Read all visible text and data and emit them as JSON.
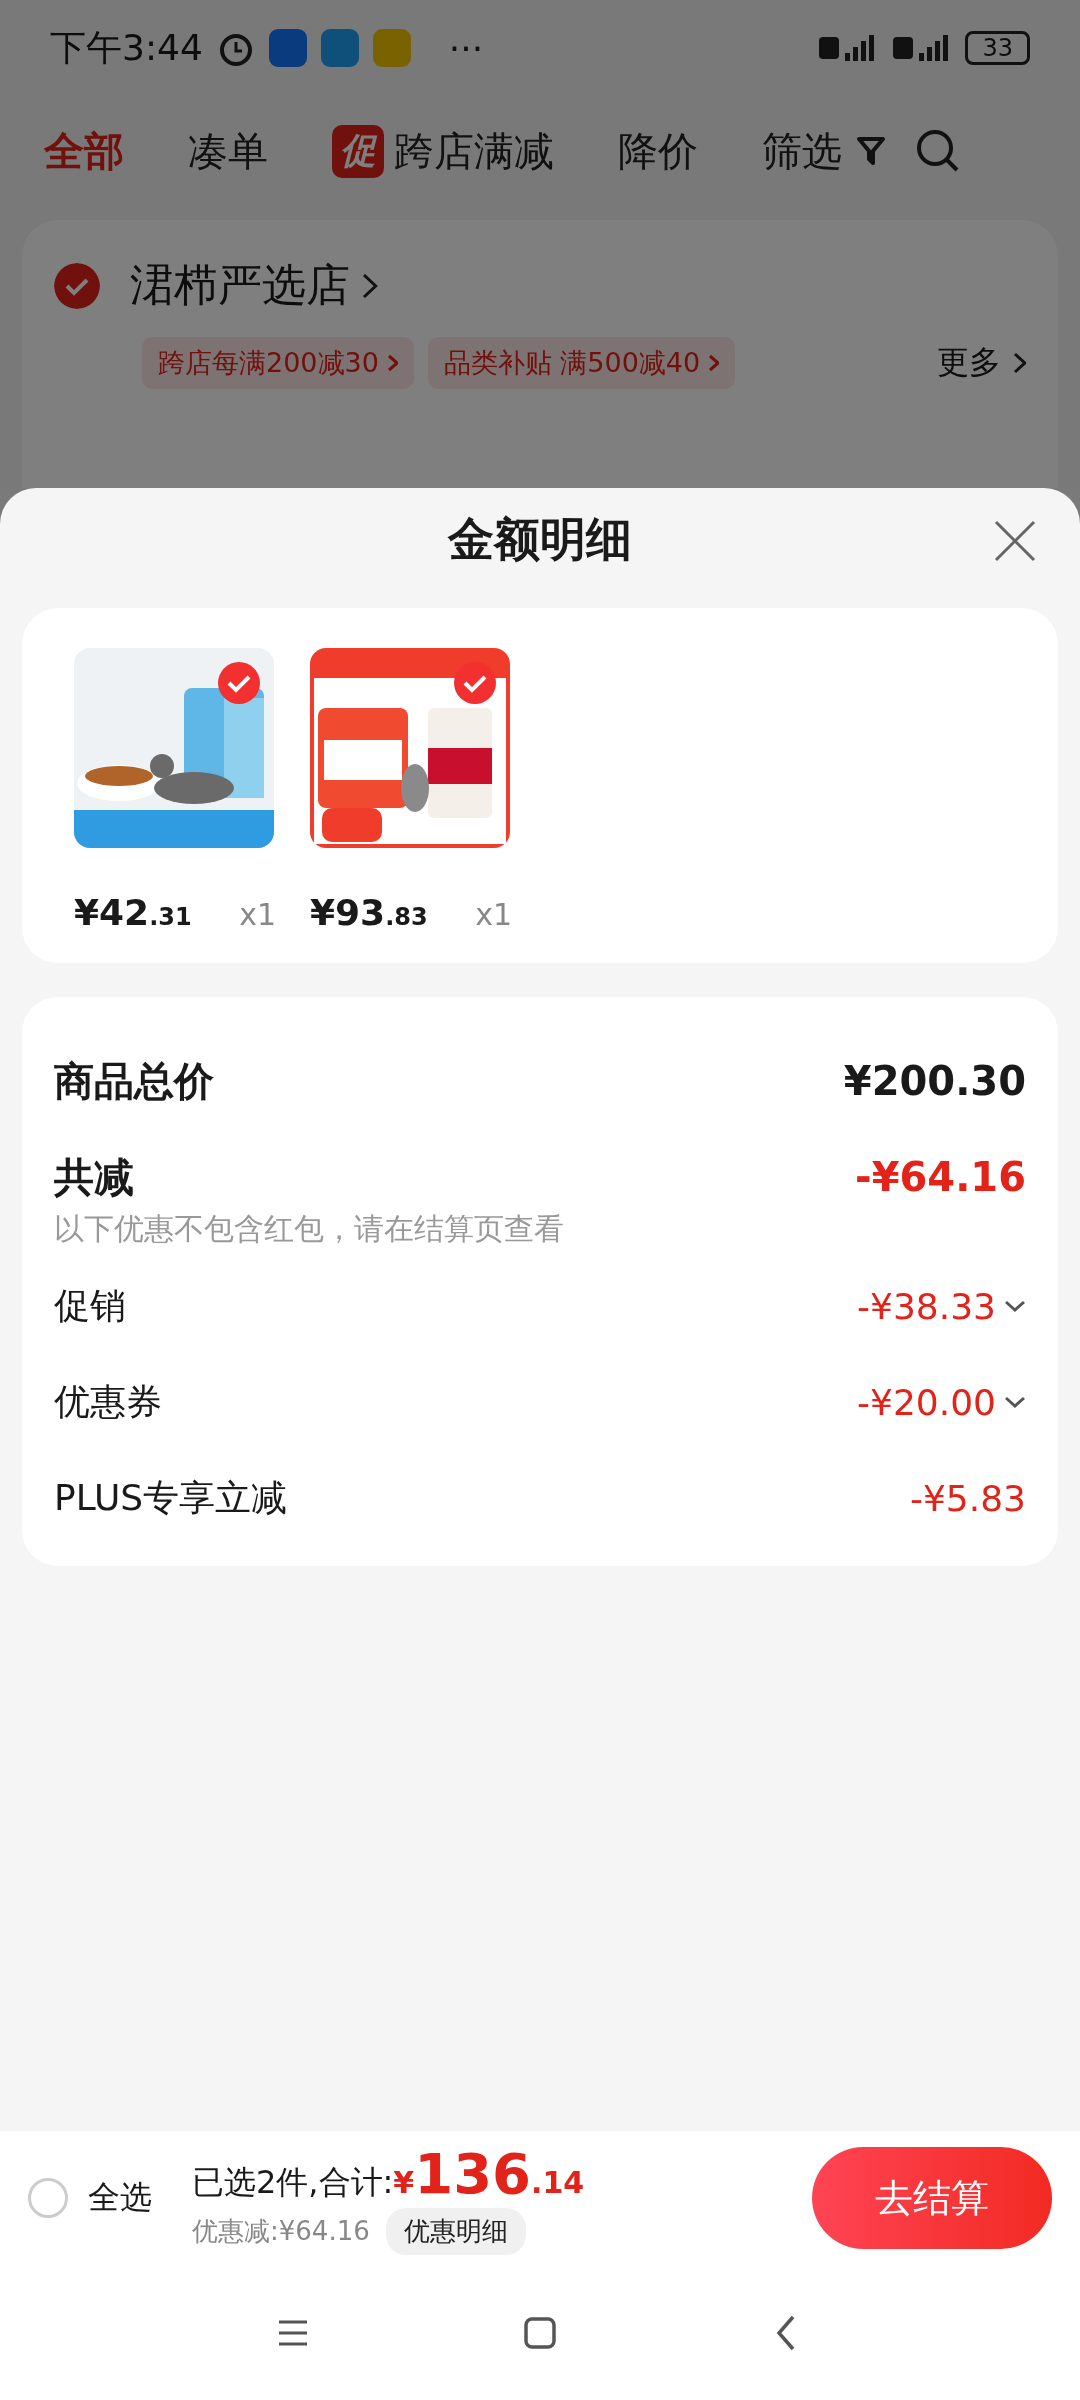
{
  "status_bar": {
    "time": "下午3:44",
    "more": "···",
    "battery": "33"
  },
  "tabs": [
    {
      "label": "全部",
      "selected": true
    },
    {
      "label": "凑单",
      "selected": false
    },
    {
      "label": "跨店满减",
      "badge": "促",
      "selected": false
    },
    {
      "label": "降价",
      "selected": false
    }
  ],
  "filter": {
    "label": "筛选"
  },
  "store": {
    "name": "涒栉严选店",
    "checked": true,
    "promos": [
      "跨店每满200减30",
      "品类补贴  满500减40"
    ],
    "more": "更多"
  },
  "sheet": {
    "title": "金额明细",
    "items": [
      {
        "checked": true,
        "price_int": "¥42",
        "price_dec": ".31",
        "qty": "x1"
      },
      {
        "checked": true,
        "price_int": "¥93",
        "price_dec": ".83",
        "qty": "x1"
      }
    ],
    "total": {
      "label": "商品总价",
      "value": "¥200.30"
    },
    "reduction": {
      "label": "共减",
      "value": "-¥64.16",
      "note": "以下优惠不包含红包，请在结算页查看"
    },
    "rows": [
      {
        "kind": "expandable",
        "label": "促销",
        "value": "-¥38.33"
      },
      {
        "kind": "expandable",
        "label": "优惠券",
        "value": "-¥20.00"
      },
      {
        "kind": "plain",
        "label": "PLUS专享立减",
        "value": "-¥5.83"
      }
    ]
  },
  "bottom_bar": {
    "select_all": {
      "label": "全选",
      "checked": false
    },
    "summary": "已选2件,合计:",
    "currency": "¥",
    "amount_int": "136",
    "amount_dec": ".14",
    "discount": "优惠减:¥64.16",
    "detail_button": "优惠明细",
    "checkout": "去结算"
  }
}
